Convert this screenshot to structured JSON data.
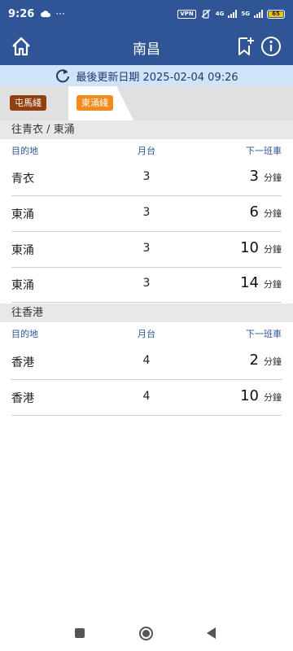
{
  "status_bar": {
    "time": "9:26",
    "dots": "···",
    "vpn": "VPN",
    "net_a": "4G",
    "net_b": "5G",
    "battery": "65"
  },
  "header": {
    "title": "南昌",
    "icons": [
      "home-icon",
      "bookmark-add-icon",
      "info-icon"
    ]
  },
  "update": {
    "label": "最後更新日期 2025-02-04 09:26"
  },
  "line_tabs": [
    {
      "label": "屯馬綫",
      "color": "#923f10",
      "active": false
    },
    {
      "label": "東涌綫",
      "color": "#f58a1a",
      "active": true
    }
  ],
  "sections": [
    {
      "title": "往青衣 / 東涌",
      "columns": {
        "dest": "目的地",
        "platform": "月台",
        "next": "下一班車"
      },
      "rows": [
        {
          "dest": "青衣",
          "platform": "3",
          "mins": "3",
          "unit": "分鐘"
        },
        {
          "dest": "東涌",
          "platform": "3",
          "mins": "6",
          "unit": "分鐘"
        },
        {
          "dest": "東涌",
          "platform": "3",
          "mins": "10",
          "unit": "分鐘"
        },
        {
          "dest": "東涌",
          "platform": "3",
          "mins": "14",
          "unit": "分鐘"
        }
      ]
    },
    {
      "title": "往香港",
      "columns": {
        "dest": "目的地",
        "platform": "月台",
        "next": "下一班車"
      },
      "rows": [
        {
          "dest": "香港",
          "platform": "4",
          "mins": "2",
          "unit": "分鐘"
        },
        {
          "dest": "香港",
          "platform": "4",
          "mins": "10",
          "unit": "分鐘"
        }
      ]
    }
  ],
  "colors": {
    "header_bg": "#2f5596",
    "update_bg": "#cfe4f7",
    "tuen_ma_line": "#923f10",
    "tung_chung_line": "#f58a1a"
  }
}
